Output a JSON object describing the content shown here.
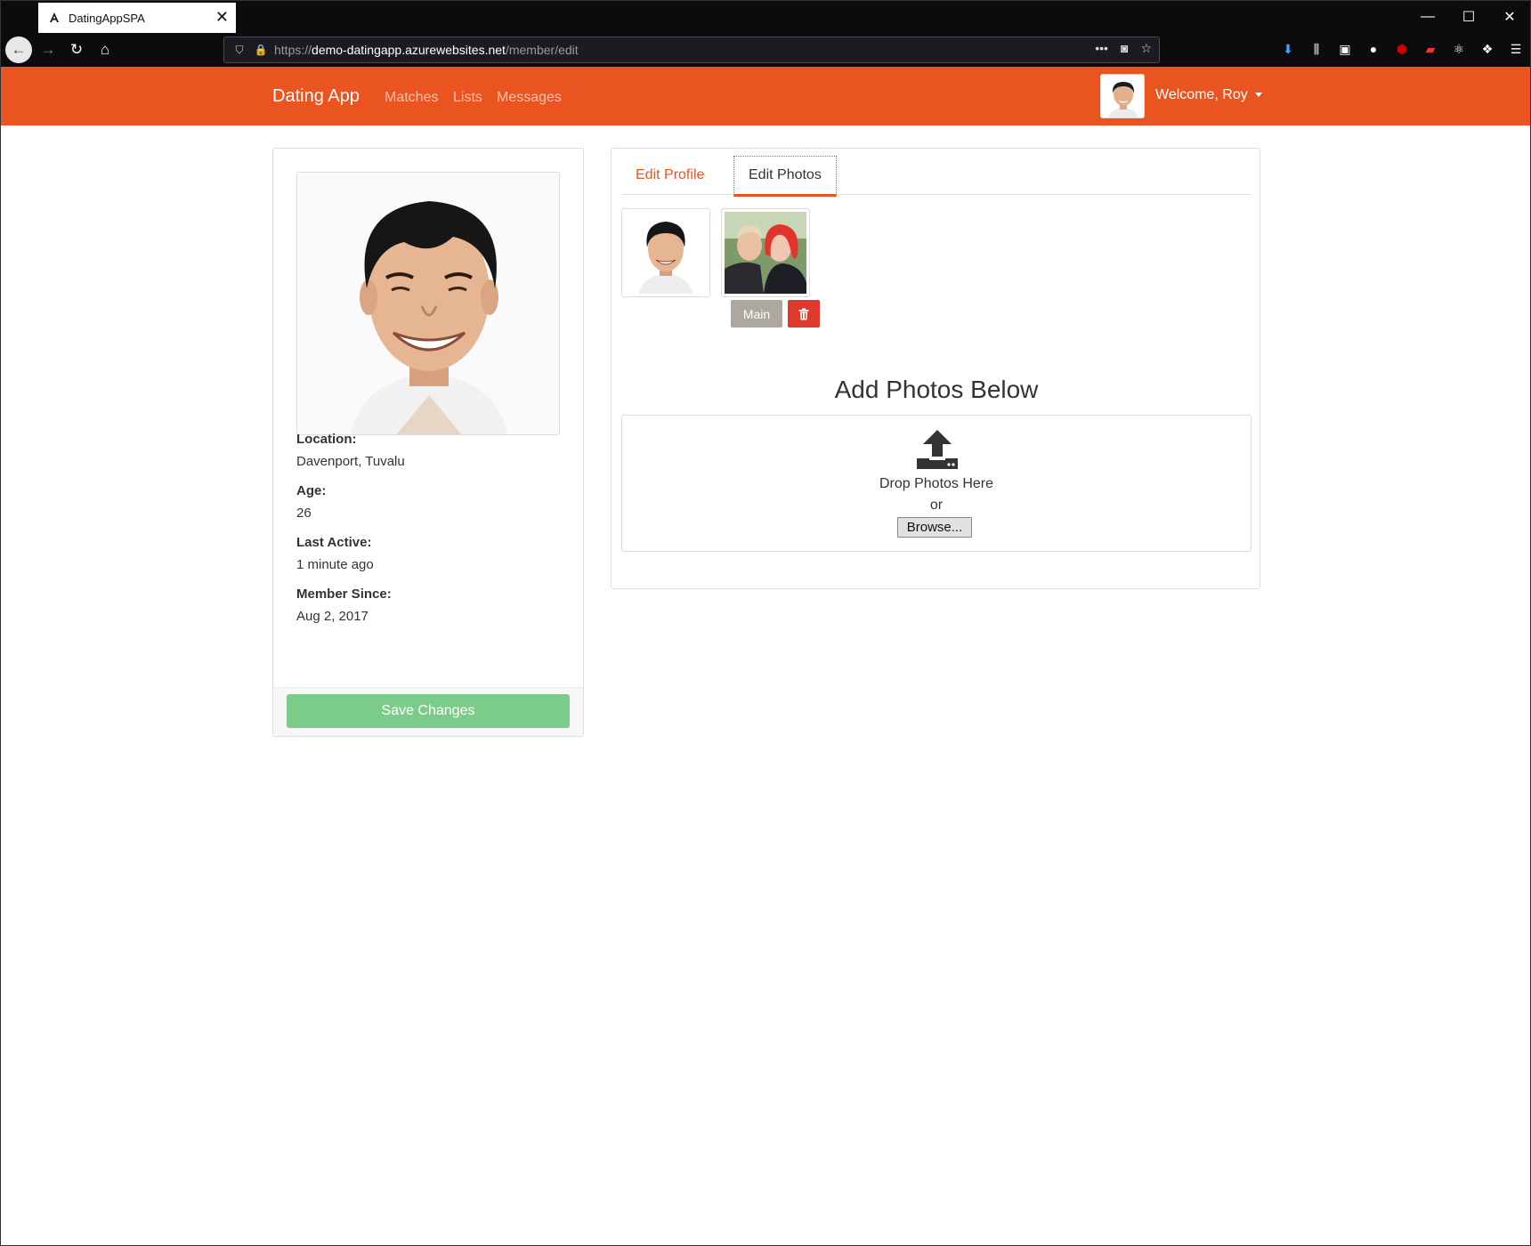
{
  "browser": {
    "tab_title": "DatingAppSPA",
    "tab_close": "✕",
    "url_base": "https://demo-datingapp.azurewebsites.net",
    "url_path": "/member/edit",
    "url_scheme": "https://",
    "url_host": "demo-datingapp.azurewebsites.net",
    "window_minimize": "—",
    "window_maximize": "☐",
    "window_close": "✕"
  },
  "app": {
    "brand": "Dating App",
    "nav": [
      "Matches",
      "Lists",
      "Messages"
    ],
    "welcome": "Welcome, Roy",
    "accent_color": "#e95420"
  },
  "profile": {
    "fields": [
      {
        "label": "Location:",
        "value": "Davenport, Tuvalu"
      },
      {
        "label": "Age:",
        "value": "26"
      },
      {
        "label": "Last Active:",
        "value": "1 minute ago"
      },
      {
        "label": "Member Since:",
        "value": "Aug 2, 2017"
      }
    ],
    "save_label": "Save Changes"
  },
  "editor": {
    "tabs": [
      "Edit Profile",
      "Edit Photos"
    ],
    "active_tab": "Edit Photos",
    "main_label": "Main",
    "add_title": "Add Photos Below",
    "drop_text": "Drop Photos Here",
    "or_text": "or",
    "browse_label": "Browse..."
  }
}
